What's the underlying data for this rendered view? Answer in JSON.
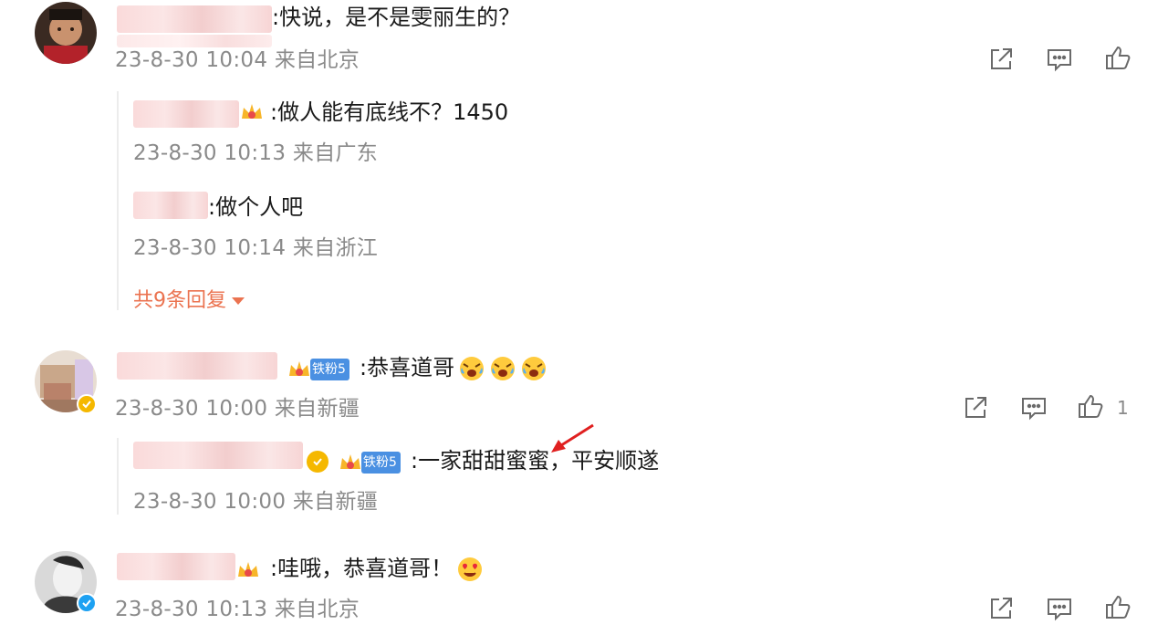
{
  "comments": [
    {
      "text": ":快说，是不是雯丽生的？",
      "meta": "23-8-30 10:04 来自北京",
      "replies": [
        {
          "text": ":做人能有底线不？1450",
          "meta": "23-8-30 10:13 来自广东"
        },
        {
          "text": ":做个人吧",
          "meta": "23-8-30 10:14 来自浙江"
        }
      ],
      "more_replies_label": "共9条回复"
    },
    {
      "text": ":恭喜道哥",
      "fan_badge": "铁粉5",
      "meta": "23-8-30 10:00 来自新疆",
      "like_count": "1",
      "replies": [
        {
          "text": ":一家甜甜蜜蜜，平安顺遂",
          "fan_badge": "铁粉5",
          "meta": "23-8-30 10:00 来自新疆"
        }
      ]
    },
    {
      "text": ":哇哦，恭喜道哥！",
      "meta": "23-8-30 10:13 来自北京"
    }
  ],
  "icons": {
    "share": "share-icon",
    "comment": "comment-icon",
    "like": "like-icon",
    "verified": "verified-icon"
  },
  "colors": {
    "accent_orange": "#eb7350",
    "meta_gray": "#8a8a8a",
    "verified_gold": "#f5b800",
    "verified_blue": "#1da1f2",
    "fan_badge_blue": "#4a90e2",
    "annotation_red": "#e02020"
  }
}
